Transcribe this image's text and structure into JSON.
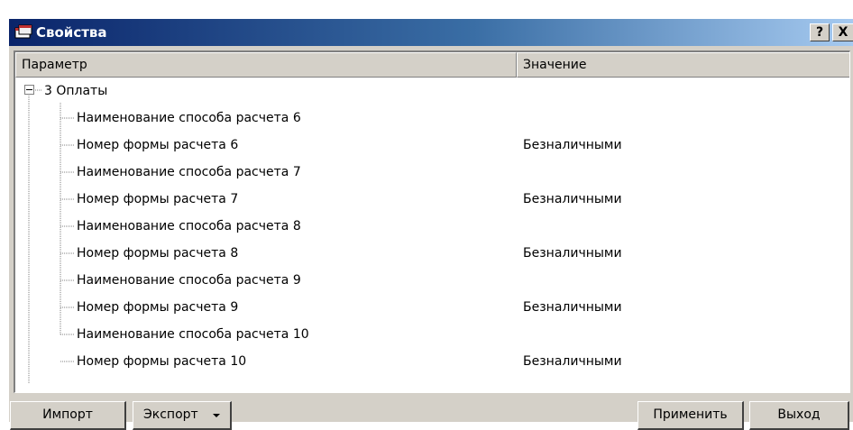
{
  "window": {
    "title": "Свойства",
    "help_label": "?",
    "close_label": "X"
  },
  "table": {
    "columns": [
      "Параметр",
      "Значение"
    ],
    "group": {
      "label": "3 Оплаты",
      "expander_glyph": "minus"
    },
    "rows": [
      {
        "param": "Наименование способа расчета 6",
        "value": ""
      },
      {
        "param": "Номер формы расчета 6",
        "value": "Безналичными"
      },
      {
        "param": "Наименование способа расчета 7",
        "value": ""
      },
      {
        "param": "Номер формы расчета 7",
        "value": "Безналичными"
      },
      {
        "param": "Наименование способа расчета 8",
        "value": ""
      },
      {
        "param": "Номер формы расчета 8",
        "value": "Безналичными"
      },
      {
        "param": "Наименование способа расчета 9",
        "value": ""
      },
      {
        "param": "Номер формы расчета 9",
        "value": "Безналичными"
      },
      {
        "param": "Наименование способа расчета 10",
        "value": ""
      },
      {
        "param": "Номер формы расчета 10",
        "value": "Безналичными"
      }
    ]
  },
  "buttons": {
    "import": "Импорт",
    "export": "Экспорт",
    "apply": "Применить",
    "exit": "Выход"
  },
  "icons": {
    "app": "app-window-icon",
    "export_menu": "chevron-down-icon"
  },
  "colors": {
    "titlebar_start": "#0a246a",
    "titlebar_end": "#a6caf0",
    "face": "#d4d0c8"
  }
}
